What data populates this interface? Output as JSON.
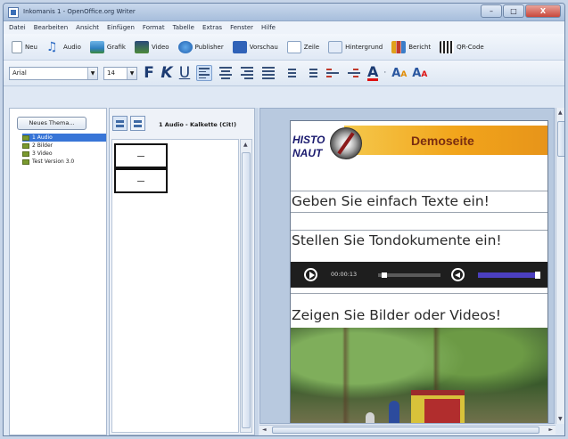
{
  "window": {
    "title": "Inkomanis 1 - OpenOffice.org Writer",
    "buttons": [
      "–",
      "□",
      "X"
    ]
  },
  "menu": [
    "Datei",
    "Bearbeiten",
    "Ansicht",
    "Einfügen",
    "Format",
    "Tabelle",
    "Extras",
    "Fenster",
    "Hilfe"
  ],
  "toolbar": {
    "new_label": "Neu",
    "audio_label": "Audio",
    "graphic_label": "Grafik",
    "video_label": "Video",
    "publisher_label": "Publisher",
    "viewer_label": "Vorschau",
    "line_label": "Zeile",
    "background_label": "Hintergrund",
    "reports_label": "Bericht",
    "qr_label": "QR-Code"
  },
  "format_bar": {
    "font": "Arial",
    "size": "14",
    "bold": "F",
    "italic": "K",
    "underline": "U"
  },
  "left_panel": {
    "new_topic_button": "Neues Thema...",
    "items": [
      "1 Audio",
      "2 Bilder",
      "3 Video",
      "Test Version 3.0"
    ],
    "selected_index": 0
  },
  "middle_panel": {
    "title": "1 Audio - Kalkette (Cit!)"
  },
  "page": {
    "logo_top": "HISTO",
    "logo_bottom": "NAUT",
    "banner_title": "Demoseite",
    "line1": "Geben Sie einfach Texte ein!",
    "line2": "Stellen Sie Tondokumente ein!",
    "line3": "Zeigen Sie Bilder oder Videos!",
    "audio_time": "00:00:13",
    "audio_progress": 0.05,
    "audio_volume": 1.0
  }
}
